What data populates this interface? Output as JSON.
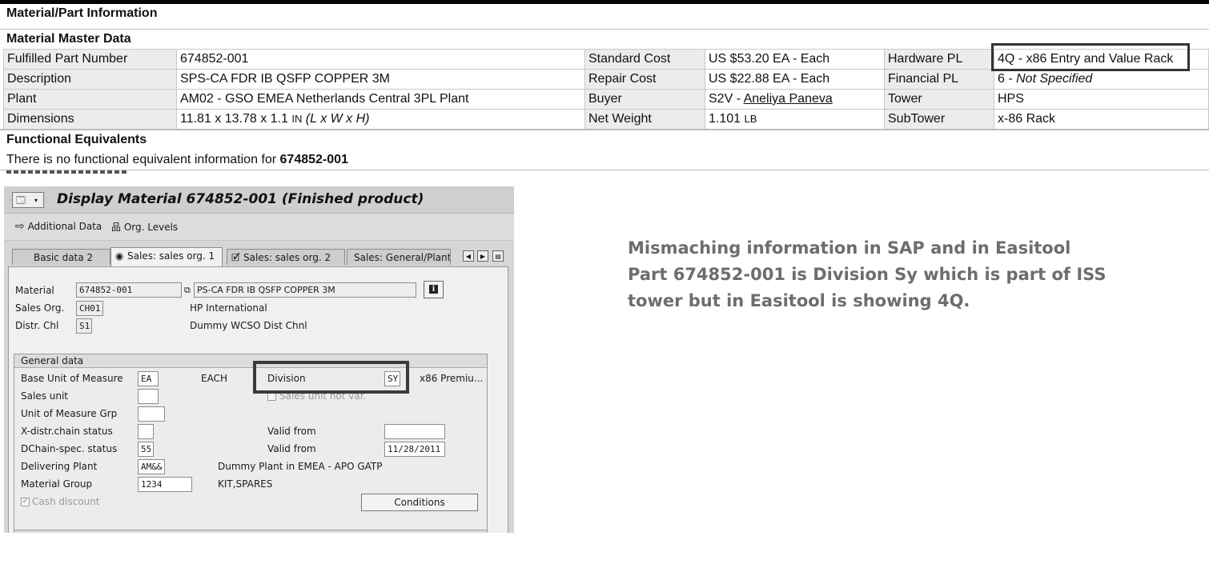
{
  "page": {
    "title": "Material/Part Information"
  },
  "master": {
    "title": "Material Master Data",
    "rows": [
      {
        "l1": "Fulfilled Part Number",
        "v1": "674852-001",
        "l2": "Standard Cost",
        "v2": "US $53.20 EA - Each",
        "l3": "Hardware PL",
        "v3": "4Q - x86 Entry and Value Rack"
      },
      {
        "l1": "Description",
        "v1": "SPS-CA FDR IB QSFP COPPER 3M",
        "l2": "Repair Cost",
        "v2": "US $22.88 EA - Each",
        "l3": "Financial PL",
        "v3a": "6 - ",
        "v3b": "Not Specified"
      },
      {
        "l1": "Plant",
        "v1": "AM02 - GSO EMEA Netherlands Central 3PL Plant",
        "l2": "Buyer",
        "v2a": "S2V - ",
        "v2b": "Aneliya Paneva",
        "l3": "Tower",
        "v3": "HPS"
      },
      {
        "l1": "Dimensions",
        "v1a": "11.81 x 13.78 x 1.1 ",
        "v1u": "IN",
        "v1b": " (L x W x H)",
        "l2": "Net Weight",
        "v2a": "1.101 ",
        "v2u": "LB",
        "l3": "SubTower",
        "v3": "x-86 Rack"
      }
    ]
  },
  "functional": {
    "title": "Functional Equivalents",
    "text": "There is no functional equivalent information for ",
    "part": "674852-001"
  },
  "sap": {
    "window_title": "Display Material 674852-001 (Finished product)",
    "toolbar": {
      "additional_data": "Additional Data",
      "org_levels": "Org. Levels"
    },
    "tabs": [
      "Basic data 2",
      "Sales: sales org. 1",
      "Sales: sales org. 2",
      "Sales: General/Plant"
    ],
    "active_tab": "Sales: sales org. 1",
    "header": {
      "material_label": "Material",
      "material_value": "674852-001",
      "material_desc": "PS-CA FDR IB QSFP COPPER 3M",
      "sales_org_label": "Sales Org.",
      "sales_org_value": "CH01",
      "sales_org_desc": "HP International",
      "distr_chl_label": "Distr. Chl",
      "distr_chl_value": "S1",
      "distr_chl_desc": "Dummy WCSO Dist Chnl"
    },
    "general": {
      "title": "General data",
      "base_uom_label": "Base Unit of Measure",
      "base_uom_value": "EA",
      "base_uom_desc": "EACH",
      "division_label": "Division",
      "division_value": "SY",
      "division_desc": "x86 Premiu...",
      "sales_unit_label": "Sales unit",
      "sales_unit_not_var": "Sales unit not var.",
      "uom_grp_label": "Unit of Measure Grp",
      "xdistr_label": "X-distr.chain status",
      "valid_from_label_1": "Valid from",
      "dchain_label": "DChain-spec. status",
      "dchain_value": "55",
      "valid_from_label_2": "Valid from",
      "valid_from_value_2": "11/28/2011",
      "deliv_plant_label": "Delivering Plant",
      "deliv_plant_value": "AM&&",
      "deliv_plant_desc": "Dummy Plant in EMEA - APO GATP",
      "mat_group_label": "Material Group",
      "mat_group_value": "1234",
      "mat_group_desc": "KIT,SPARES",
      "cash_discount_label": "Cash discount",
      "conditions_button": "Conditions"
    }
  },
  "annotation": {
    "lines": [
      "Mismaching information in SAP and in Easitool",
      "Part 674852-001 is Division Sy which is part of ISS",
      "tower but in Easitool is showing 4Q."
    ]
  }
}
